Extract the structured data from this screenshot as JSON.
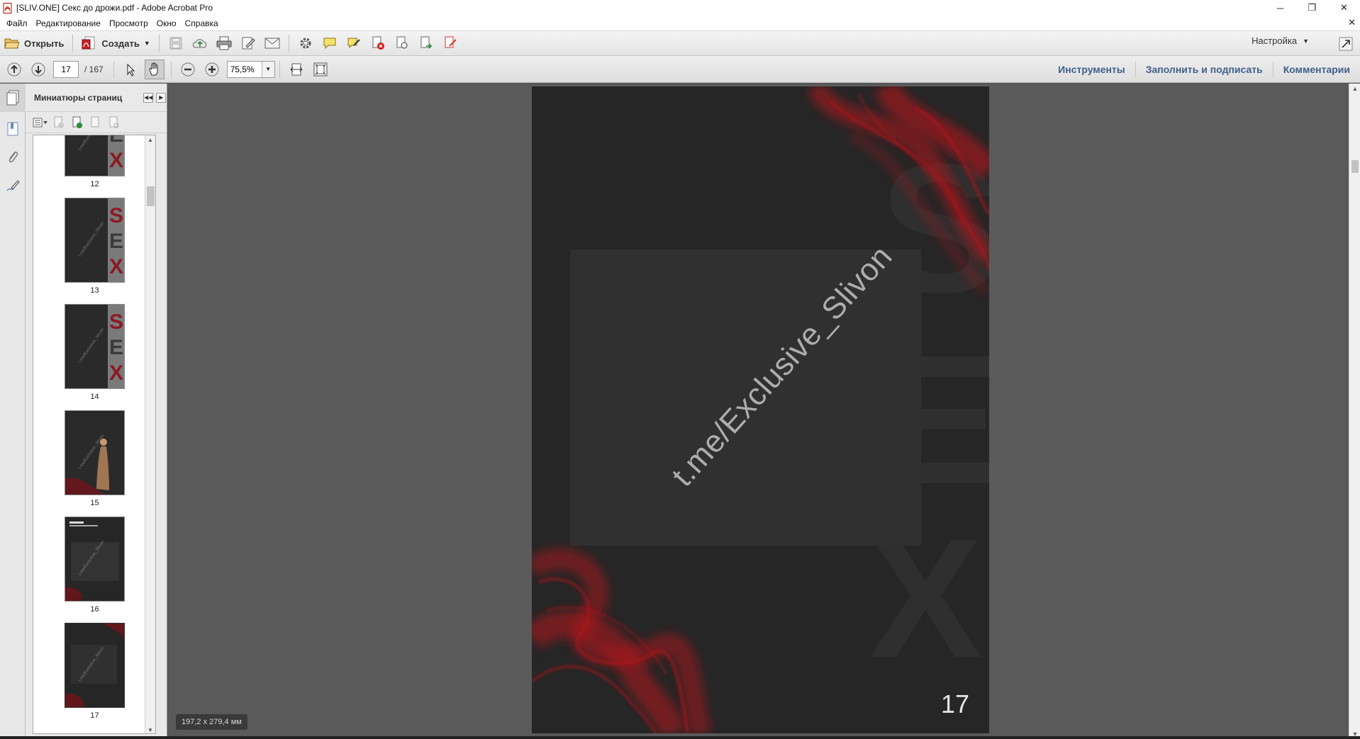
{
  "window": {
    "title": "[SLIV.ONE] Секс до дрожи.pdf - Adobe Acrobat Pro",
    "minimize": "─",
    "restore": "❐",
    "close": "✕"
  },
  "menu": {
    "items": [
      "Файл",
      "Редактирование",
      "Просмотр",
      "Окно",
      "Справка"
    ],
    "close_doc": "✕"
  },
  "toolbar": {
    "open_label": "Открыть",
    "create_label": "Создать",
    "settings_label": "Настройка"
  },
  "navigation": {
    "current_page": "17",
    "total_pages": "/ 167",
    "zoom": "75,5%"
  },
  "right_tabs": {
    "tools": "Инструменты",
    "fill_sign": "Заполнить и подписать",
    "comments": "Комментарии"
  },
  "thumbnail_panel": {
    "title": "Миниатюры страниц",
    "pages": [
      {
        "number": "12",
        "style": "sex"
      },
      {
        "number": "13",
        "style": "sex"
      },
      {
        "number": "14",
        "style": "sex"
      },
      {
        "number": "15",
        "style": "figure"
      },
      {
        "number": "16",
        "style": "text"
      },
      {
        "number": "17",
        "style": "smoke"
      }
    ],
    "thumb_watermark": "t.me/Exclusive_Slivon"
  },
  "document": {
    "watermark": "t.me/Exclusive_Slivon",
    "page_number": "17",
    "page_size": "197,2 x 279,4 мм",
    "background_letters": [
      "S",
      "E",
      "X"
    ]
  },
  "colors": {
    "accent_tab": "#3f5f8c",
    "page_bg": "#262626",
    "smoke_red": "#b3141a"
  }
}
